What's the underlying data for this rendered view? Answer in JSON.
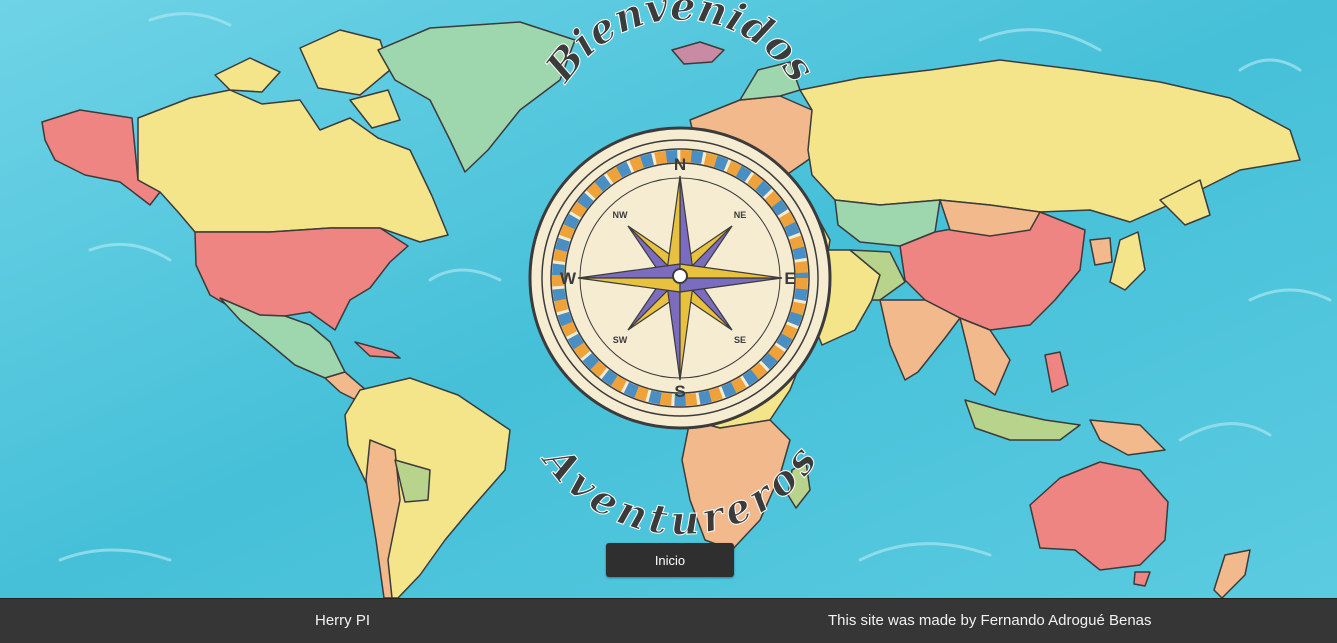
{
  "hero": {
    "title_top": "Bienvenidos",
    "title_bottom": "Aventureros",
    "compass": {
      "north": "N",
      "south": "S",
      "east": "E",
      "west": "W",
      "ne": "NE",
      "nw": "NW",
      "se": "SE",
      "sw": "SW"
    }
  },
  "actions": {
    "start_label": "Inicio"
  },
  "footer": {
    "left_text": "Herry PI",
    "right_text": "This site was made by Fernando Adrogué Benas"
  },
  "colors": {
    "ocean": "#4cc5db",
    "land_yellow": "#f4e58a",
    "land_red": "#ef8582",
    "land_green": "#9ed6ae",
    "land_peach": "#f2b98c",
    "compass_face": "#f6ecd2",
    "compass_orange": "#f0a23a",
    "compass_blue": "#4a8fc4",
    "compass_purple": "#7c6cbf",
    "compass_gold": "#e8c23f",
    "footer_bg": "#363636",
    "button_bg": "#2f2f2f"
  }
}
